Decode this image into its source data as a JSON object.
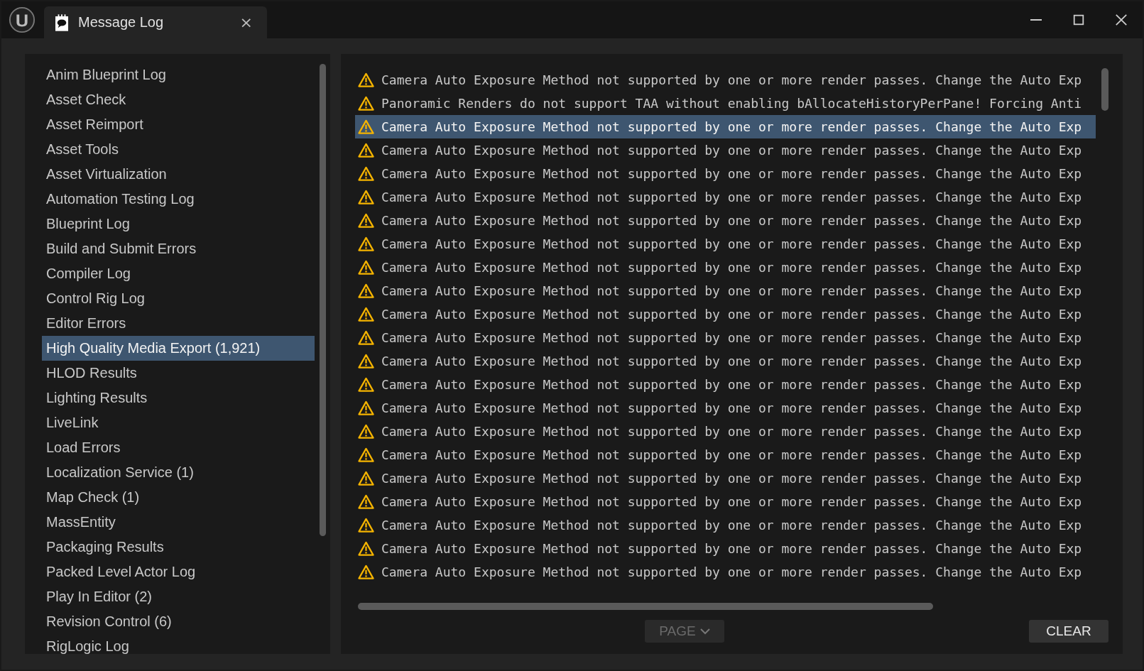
{
  "tab": {
    "title": "Message Log",
    "close": "×"
  },
  "sidebar": {
    "items": [
      {
        "label": "Anim Blueprint Log",
        "selected": false
      },
      {
        "label": "Asset Check",
        "selected": false
      },
      {
        "label": "Asset Reimport",
        "selected": false
      },
      {
        "label": "Asset Tools",
        "selected": false
      },
      {
        "label": "Asset Virtualization",
        "selected": false
      },
      {
        "label": "Automation Testing Log",
        "selected": false
      },
      {
        "label": "Blueprint Log",
        "selected": false
      },
      {
        "label": "Build and Submit Errors",
        "selected": false
      },
      {
        "label": "Compiler Log",
        "selected": false
      },
      {
        "label": "Control Rig Log",
        "selected": false
      },
      {
        "label": "Editor Errors",
        "selected": false
      },
      {
        "label": "High Quality Media Export (1,921)",
        "selected": true
      },
      {
        "label": "HLOD Results",
        "selected": false
      },
      {
        "label": "Lighting Results",
        "selected": false
      },
      {
        "label": "LiveLink",
        "selected": false
      },
      {
        "label": "Load Errors",
        "selected": false
      },
      {
        "label": "Localization Service (1)",
        "selected": false
      },
      {
        "label": "Map Check (1)",
        "selected": false
      },
      {
        "label": "MassEntity",
        "selected": false
      },
      {
        "label": "Packaging Results",
        "selected": false
      },
      {
        "label": "Packed Level Actor Log",
        "selected": false
      },
      {
        "label": "Play In Editor (2)",
        "selected": false
      },
      {
        "label": "Revision Control (6)",
        "selected": false
      },
      {
        "label": "RigLogic Log",
        "selected": false
      }
    ]
  },
  "log": {
    "rows": [
      {
        "kind": "warning",
        "text": "Camera Auto Exposure Method not supported by one or more render passes. Change the Auto Exp",
        "selected": false
      },
      {
        "kind": "warning",
        "text": "Panoramic Renders do not support TAA without enabling bAllocateHistoryPerPane! Forcing Anti",
        "selected": false
      },
      {
        "kind": "warning",
        "text": "Camera Auto Exposure Method not supported by one or more render passes. Change the Auto Exp",
        "selected": true
      },
      {
        "kind": "warning",
        "text": "Camera Auto Exposure Method not supported by one or more render passes. Change the Auto Exp",
        "selected": false
      },
      {
        "kind": "warning",
        "text": "Camera Auto Exposure Method not supported by one or more render passes. Change the Auto Exp",
        "selected": false
      },
      {
        "kind": "warning",
        "text": "Camera Auto Exposure Method not supported by one or more render passes. Change the Auto Exp",
        "selected": false
      },
      {
        "kind": "warning",
        "text": "Camera Auto Exposure Method not supported by one or more render passes. Change the Auto Exp",
        "selected": false
      },
      {
        "kind": "warning",
        "text": "Camera Auto Exposure Method not supported by one or more render passes. Change the Auto Exp",
        "selected": false
      },
      {
        "kind": "warning",
        "text": "Camera Auto Exposure Method not supported by one or more render passes. Change the Auto Exp",
        "selected": false
      },
      {
        "kind": "warning",
        "text": "Camera Auto Exposure Method not supported by one or more render passes. Change the Auto Exp",
        "selected": false
      },
      {
        "kind": "warning",
        "text": "Camera Auto Exposure Method not supported by one or more render passes. Change the Auto Exp",
        "selected": false
      },
      {
        "kind": "warning",
        "text": "Camera Auto Exposure Method not supported by one or more render passes. Change the Auto Exp",
        "selected": false
      },
      {
        "kind": "warning",
        "text": "Camera Auto Exposure Method not supported by one or more render passes. Change the Auto Exp",
        "selected": false
      },
      {
        "kind": "warning",
        "text": "Camera Auto Exposure Method not supported by one or more render passes. Change the Auto Exp",
        "selected": false
      },
      {
        "kind": "warning",
        "text": "Camera Auto Exposure Method not supported by one or more render passes. Change the Auto Exp",
        "selected": false
      },
      {
        "kind": "warning",
        "text": "Camera Auto Exposure Method not supported by one or more render passes. Change the Auto Exp",
        "selected": false
      },
      {
        "kind": "warning",
        "text": "Camera Auto Exposure Method not supported by one or more render passes. Change the Auto Exp",
        "selected": false
      },
      {
        "kind": "warning",
        "text": "Camera Auto Exposure Method not supported by one or more render passes. Change the Auto Exp",
        "selected": false
      },
      {
        "kind": "warning",
        "text": "Camera Auto Exposure Method not supported by one or more render passes. Change the Auto Exp",
        "selected": false
      },
      {
        "kind": "warning",
        "text": "Camera Auto Exposure Method not supported by one or more render passes. Change the Auto Exp",
        "selected": false
      },
      {
        "kind": "warning",
        "text": "Camera Auto Exposure Method not supported by one or more render passes. Change the Auto Exp",
        "selected": false
      },
      {
        "kind": "warning",
        "text": "Camera Auto Exposure Method not supported by one or more render passes. Change the Auto Exp",
        "selected": false
      }
    ]
  },
  "buttons": [
    {
      "label": "PAGE",
      "kind": "dropdown",
      "disabled": true
    },
    {
      "label": "CLEAR",
      "kind": "plain",
      "disabled": false
    }
  ]
}
